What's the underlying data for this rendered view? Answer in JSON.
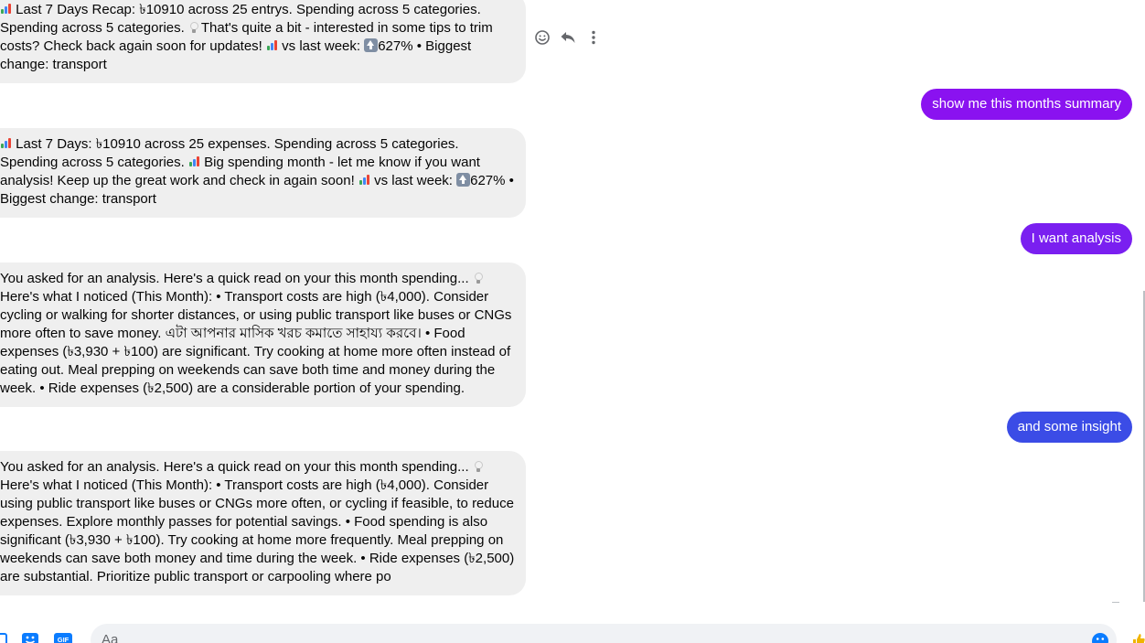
{
  "colors": {
    "incoming_bubble": "#efefef",
    "outgoing_1": "#8a12f0",
    "outgoing_2": "#7a1ff0",
    "outgoing_3": "#3b4ce6",
    "icon_gray": "#65676b",
    "accent_blue": "#0a7cff"
  },
  "messages": [
    {
      "direction": "incoming",
      "segments": [
        {
          "type": "icon",
          "icon": "bar-chart-emoji"
        },
        {
          "type": "text",
          "text": " Last 7 Days Recap: ৳10910 across 25 entrys. Spending across 5 categories. Spending across 5 categories. "
        },
        {
          "type": "icon",
          "icon": "lightbulb-emoji"
        },
        {
          "type": "text",
          "text": "  That's quite a bit - interested in some tips to trim costs? Check back again soon for updates! "
        },
        {
          "type": "icon",
          "icon": "bar-chart-emoji"
        },
        {
          "type": "text",
          "text": " vs last week: "
        },
        {
          "type": "icon",
          "icon": "up-arrow-emoji"
        },
        {
          "type": "text",
          "text": "627% • Biggest change: transport"
        }
      ]
    },
    {
      "direction": "outgoing",
      "text": "show me this months summary"
    },
    {
      "direction": "incoming",
      "segments": [
        {
          "type": "icon",
          "icon": "bar-chart-emoji"
        },
        {
          "type": "text",
          "text": " Last 7 Days: ৳10910 across 25 expenses. Spending across 5 categories. Spending across 5 categories. "
        },
        {
          "type": "icon",
          "icon": "bar-chart-emoji"
        },
        {
          "type": "text",
          "text": " Big spending month - let me know if you want analysis! Keep up the great work and check in again soon! "
        },
        {
          "type": "icon",
          "icon": "bar-chart-emoji"
        },
        {
          "type": "text",
          "text": " vs last week: "
        },
        {
          "type": "icon",
          "icon": "up-arrow-emoji"
        },
        {
          "type": "text",
          "text": "627% • Biggest change: transport"
        }
      ]
    },
    {
      "direction": "outgoing",
      "text": "I want analysis"
    },
    {
      "direction": "incoming",
      "segments": [
        {
          "type": "text",
          "text": "You asked for an analysis. Here's a quick read on your this month spending... "
        },
        {
          "type": "icon",
          "icon": "lightbulb-emoji"
        },
        {
          "type": "text",
          "text": " Here's what I noticed (This Month): • Transport costs are high (৳4,000). Consider cycling or walking for shorter distances, or using public transport like buses or CNGs more often to save money. এটা আপনার মাসিক খরচ কমাতে সাহায্য করবে। • Food expenses (৳3,930 + ৳100) are significant. Try cooking at home more often instead of eating out. Meal prepping on weekends can save both time and money during the week. • Ride expenses (৳2,500) are a considerable portion of your spending."
        }
      ]
    },
    {
      "direction": "outgoing",
      "text": "and some insight"
    },
    {
      "direction": "incoming",
      "segments": [
        {
          "type": "text",
          "text": "You asked for an analysis. Here's a quick read on your this month spending... "
        },
        {
          "type": "icon",
          "icon": "lightbulb-emoji"
        },
        {
          "type": "text",
          "text": " Here's what I noticed (This Month): • Transport costs are high (৳4,000). Consider using public transport like buses or CNGs more often, or cycling if feasible, to reduce expenses. Explore monthly passes for potential savings. • Food spending is also significant (৳3,930 + ৳100). Try cooking at home more frequently. Meal prepping on weekends can save both money and time during the week. • Ride expenses (৳2,500) are substantial. Prioritize public transport or carpooling where po"
        }
      ]
    }
  ],
  "message_actions": {
    "icons": [
      "react-emoji-icon",
      "reply-icon",
      "more-options-icon"
    ]
  },
  "composer": {
    "placeholder": "Aa",
    "left_icons": [
      "attachment-icon",
      "sticker-icon",
      "gif-icon"
    ],
    "gif_label": "GIF",
    "right_icons": [
      "emoji-icon",
      "like-thumb-icon"
    ]
  }
}
